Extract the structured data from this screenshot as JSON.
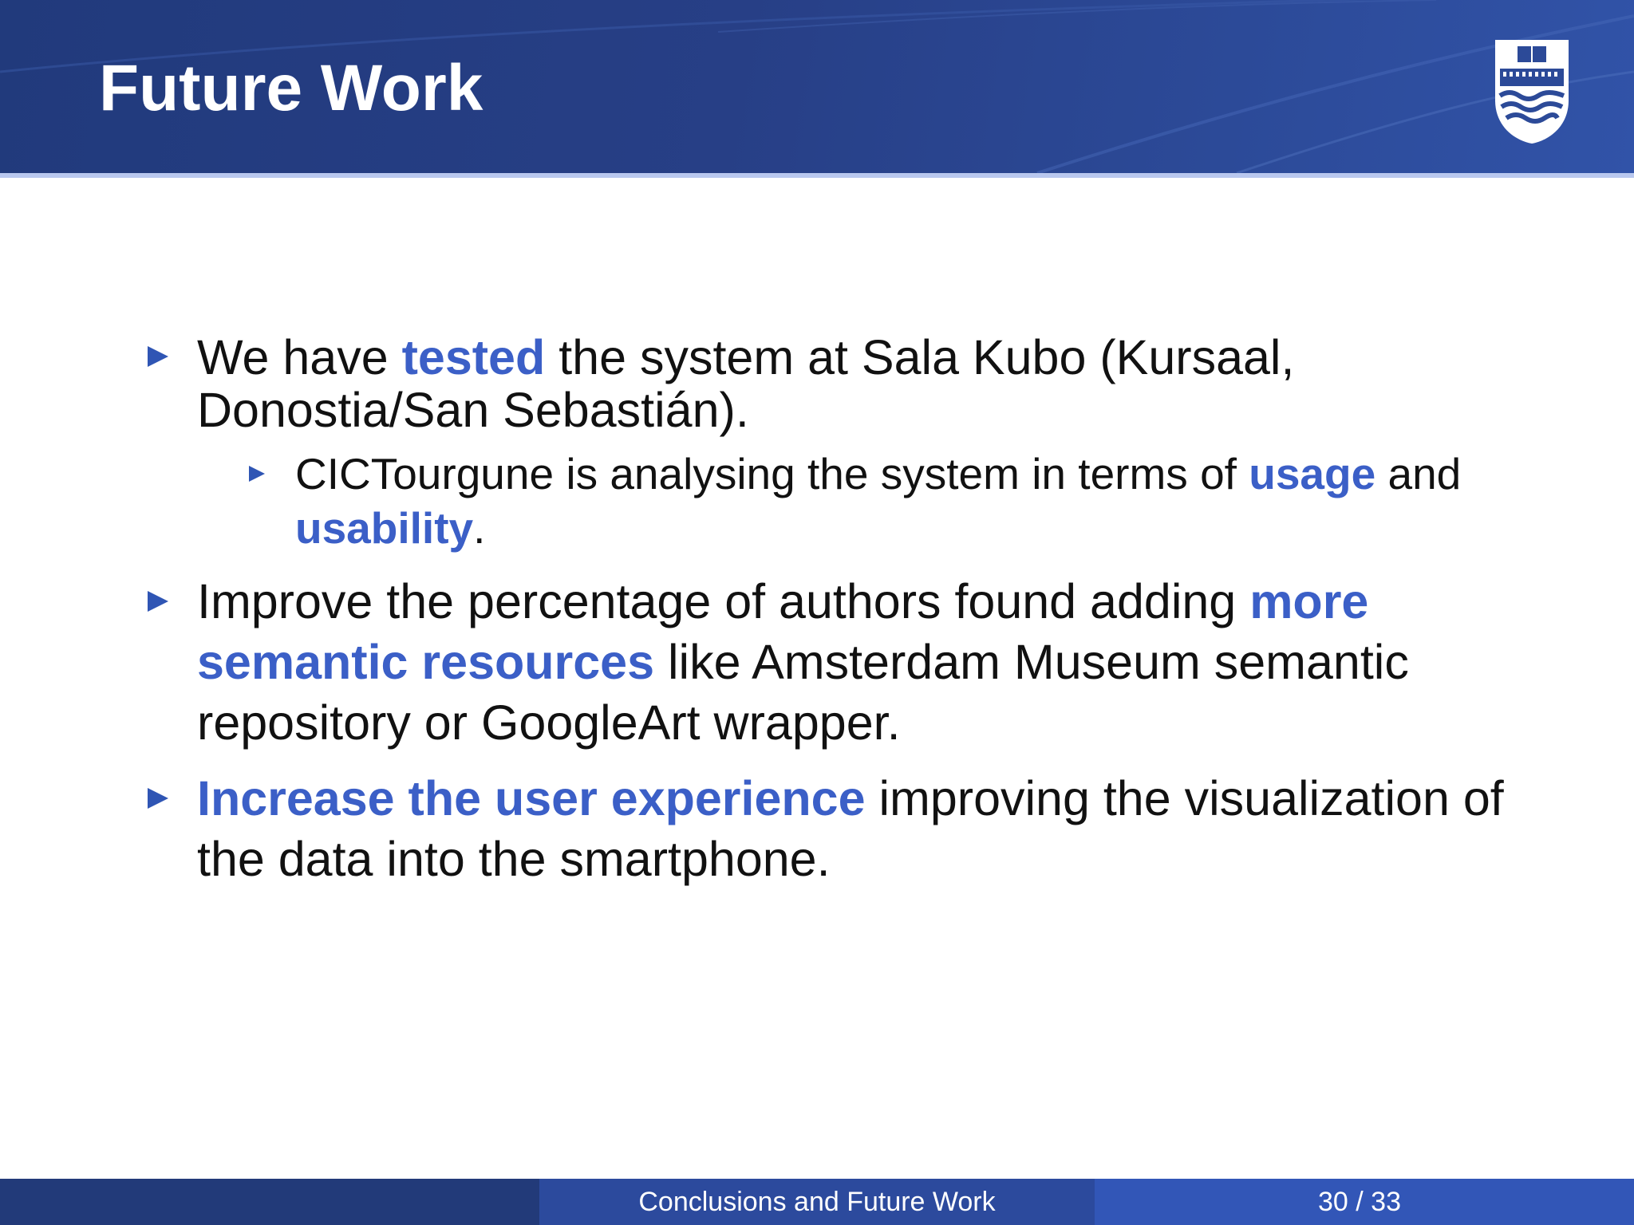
{
  "slide": {
    "title": "Future Work"
  },
  "logo": {
    "icon": "university-shield-logo"
  },
  "bullets": [
    {
      "parts": [
        {
          "text": "We have ",
          "emphasis": false
        },
        {
          "text": "tested",
          "emphasis": true
        },
        {
          "text": " the system at Sala Kubo (Kursaal,",
          "emphasis": false
        }
      ],
      "line2": "Donostia/San Sebastián).",
      "sub": {
        "line1_parts": [
          {
            "text": "CICTourgune is analysing the system in terms of ",
            "emphasis": false
          },
          {
            "text": "usage",
            "emphasis": true
          },
          {
            "text": " and",
            "emphasis": false
          }
        ],
        "line2_parts": [
          {
            "text": "usability",
            "emphasis": true
          },
          {
            "text": ".",
            "emphasis": false
          }
        ]
      }
    },
    {
      "line1_parts": [
        {
          "text": "Improve the percentage of authors found adding ",
          "emphasis": false
        },
        {
          "text": "more",
          "emphasis": true
        }
      ],
      "line2_parts": [
        {
          "text": "semantic resources",
          "emphasis": true
        },
        {
          "text": " like Amsterdam Museum semantic",
          "emphasis": false
        }
      ],
      "line3": "repository or GoogleArt wrapper."
    },
    {
      "line1_parts": [
        {
          "text": "Increase the user experience",
          "emphasis": true
        },
        {
          "text": " improving the visualization of",
          "emphasis": false
        }
      ],
      "line2": "the data into the smartphone."
    }
  ],
  "footer": {
    "section": "Conclusions and Future Work",
    "page": "30 / 33"
  },
  "colors": {
    "header": "#273f86",
    "accent": "#3b5fc7",
    "bullet": "#2f55b4"
  }
}
